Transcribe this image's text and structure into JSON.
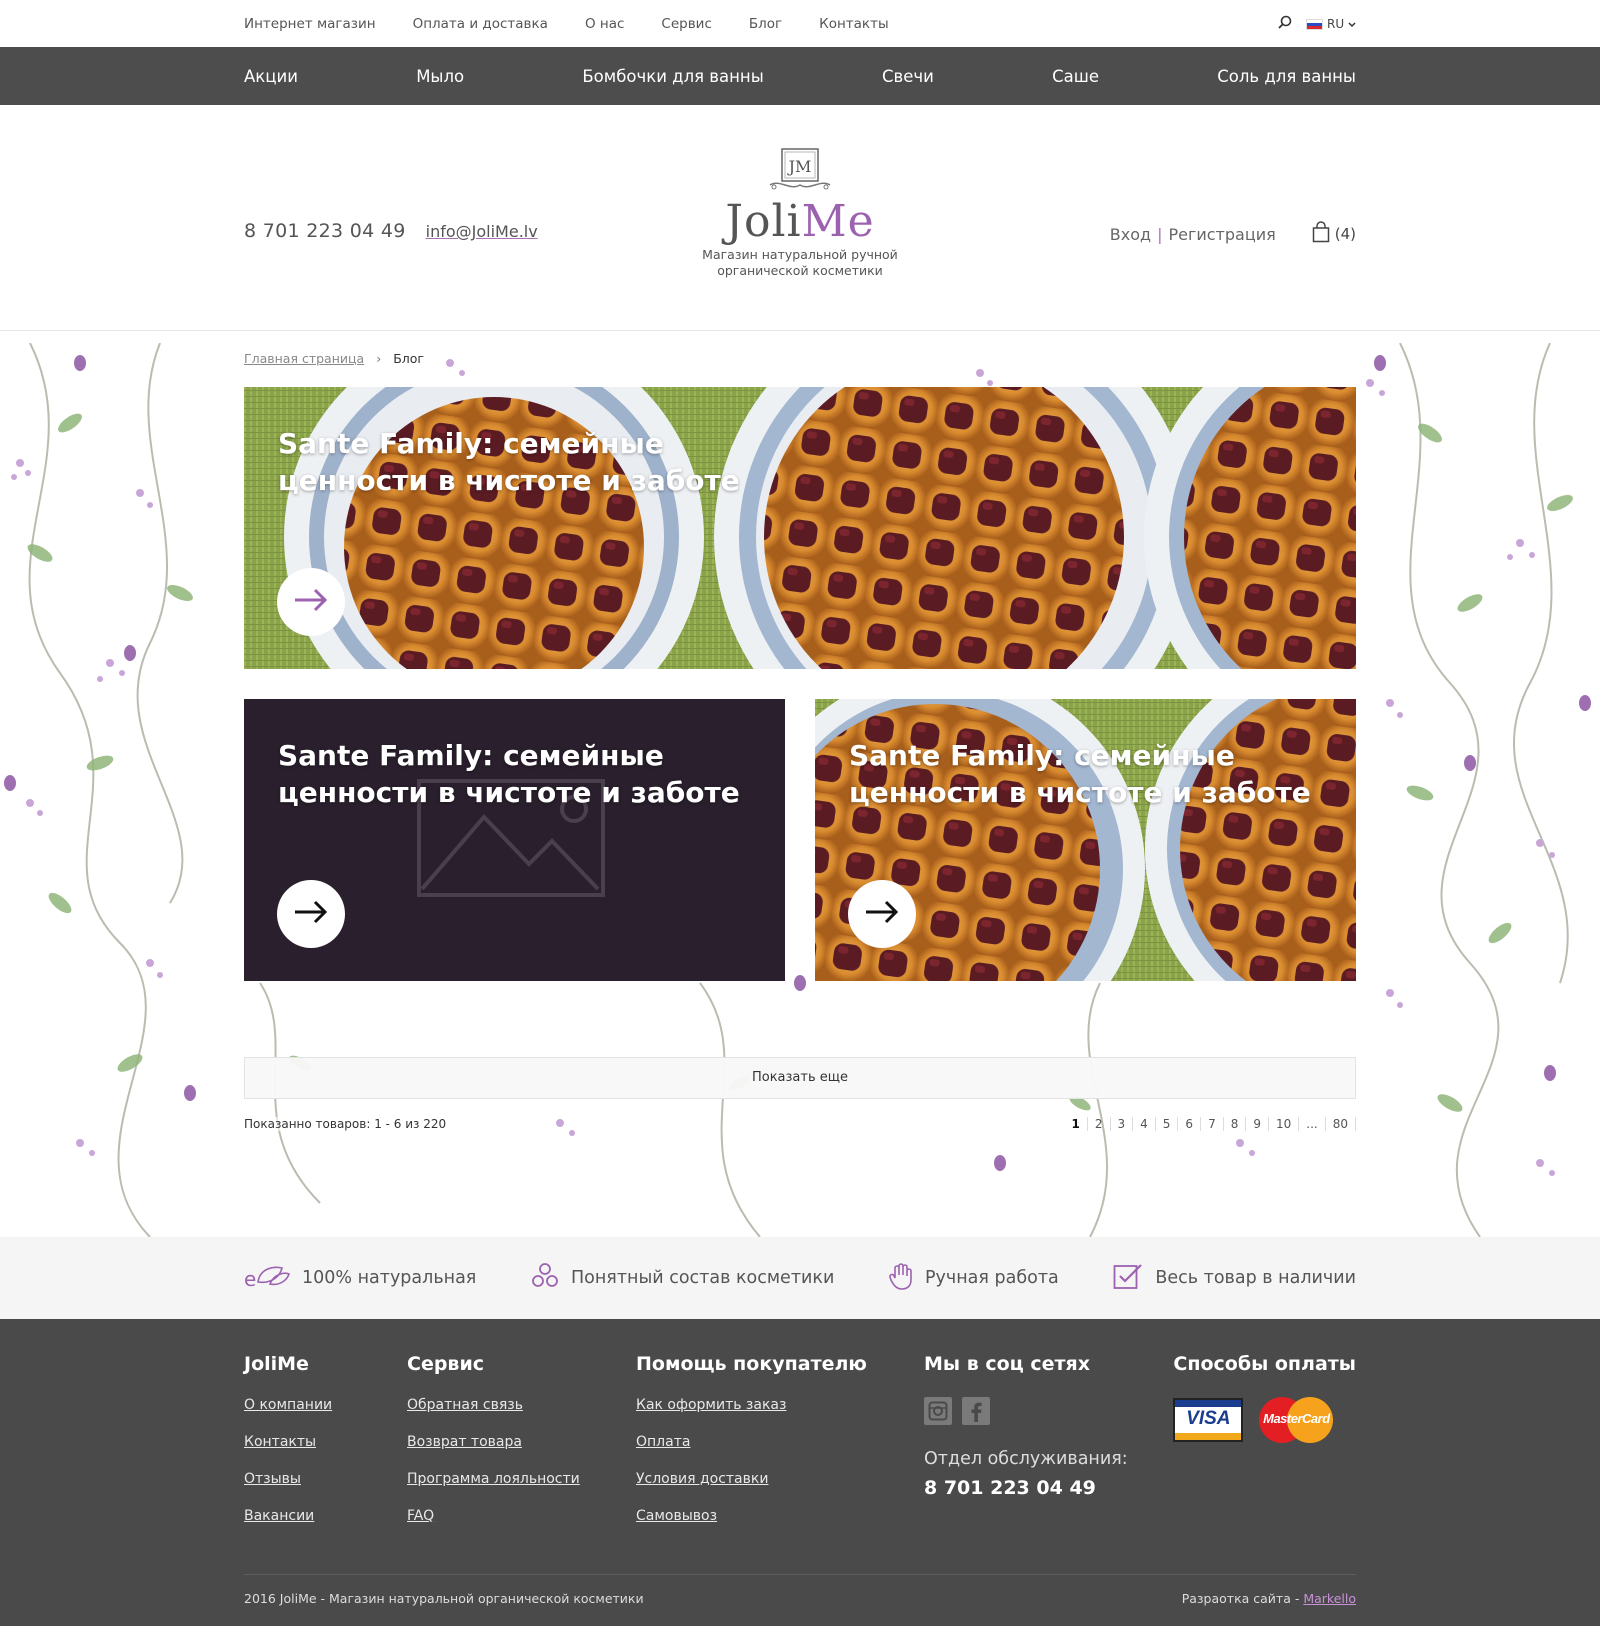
{
  "topbar": {
    "nav": [
      "Интернет магазин",
      "Оплата и доставка",
      "О нас",
      "Сервис",
      "Блог",
      "Контакты"
    ],
    "language": "RU"
  },
  "categories": [
    "Акции",
    "Мыло",
    "Бомбочки для ванны",
    "Свечи",
    "Саше",
    "Соль для ванны"
  ],
  "header": {
    "phone": "8 701 223 04 49",
    "email": "info@JoliMe.lv",
    "logo_mark": "JM",
    "logo_name_a": "Joli",
    "logo_name_b": "Me",
    "logo_sub_1": "Магазин натуральной ручной",
    "logo_sub_2": "органической косметики",
    "login": "Вход",
    "separator": "|",
    "register": "Регистрация",
    "cart_count": "(4)"
  },
  "breadcrumb": {
    "home": "Главная страница",
    "sep": "›",
    "current": "Блог"
  },
  "posts": [
    {
      "title": "Sante Family: семейные ценности в чистоте и заботе",
      "image": "pie-photo"
    },
    {
      "title": "Sante Family: семейные ценности в чистоте и заботе",
      "image": "placeholder"
    },
    {
      "title": "Sante Family: семейные ценности в чистоте и заботе",
      "image": "pie-photo"
    }
  ],
  "show_more": "Показать еще",
  "counter": "Показанно товаров: 1 - 6 из 220",
  "pagination": [
    "1",
    "2",
    "3",
    "4",
    "5",
    "6",
    "7",
    "8",
    "9",
    "10",
    "...",
    "80"
  ],
  "pagination_active": "1",
  "features": [
    {
      "icon": "eco-leaf-icon",
      "label": "100% натуральная"
    },
    {
      "icon": "molecule-icon",
      "label": "Понятный состав косметики"
    },
    {
      "icon": "hand-icon",
      "label": "Ручная работа"
    },
    {
      "icon": "checkbox-icon",
      "label": "Весь товар в наличии"
    }
  ],
  "footer": {
    "col1": {
      "title": "JoliMe",
      "links": [
        "О компании",
        "Контакты",
        "Отзывы",
        "Вакансии"
      ]
    },
    "col2": {
      "title": "Сервис",
      "links": [
        "Обратная связь",
        "Возврат товара",
        "Программа лояльности",
        "FAQ"
      ]
    },
    "col3": {
      "title": "Помощь покупателю",
      "links": [
        "Как оформить заказ",
        "Оплата",
        "Условия доставки",
        "Самовывоз"
      ]
    },
    "col4": {
      "title": "Мы в соц сетях",
      "service_label": "Отдел обслуживания:",
      "service_phone": "8 701 223 04 49"
    },
    "col5": {
      "title": "Способы оплаты",
      "visa": "VISA",
      "mastercard": "MasterCard"
    },
    "copyright": "2016 JoliMe - Магазин натуральной органической косметики",
    "dev_label": "Разраотка сайта -",
    "dev_link": "Markello"
  },
  "colors": {
    "accent": "#9c62b0",
    "dark_bar": "#4d4d4d",
    "footer_bg": "#4a4a4a",
    "dark_card": "#2a1f2d"
  }
}
